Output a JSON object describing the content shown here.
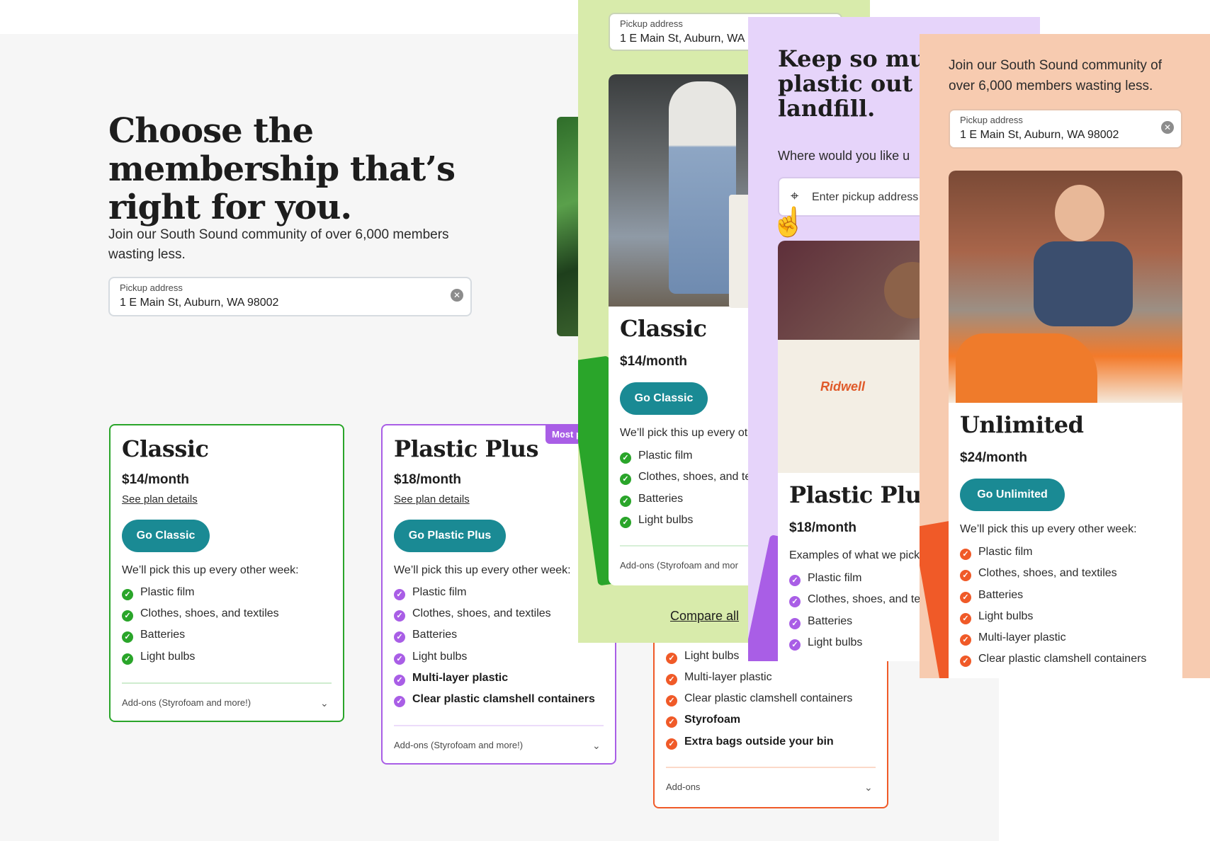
{
  "page": {
    "heading": "Choose the membership that’s right for you.",
    "subtext": "Join our South Sound community of over 6,000 members wasting less.",
    "address": {
      "label": "Pickup address",
      "value": "1 E Main St, Auburn, WA 98002"
    }
  },
  "colors": {
    "teal": "#1a8a94",
    "green": "#2aa52a",
    "purple": "#a95ee6",
    "orange": "#f05a28",
    "panel_green": "#d8ebab",
    "panel_purple": "#e6d4fa",
    "panel_peach": "#f7cbb0"
  },
  "cards": {
    "classic": {
      "title": "Classic",
      "price": "$14/month",
      "details": "See plan details",
      "button": "Go Classic",
      "intro": "We’ll pick this up every other week:",
      "features": [
        "Plastic film",
        "Clothes, shoes, and textiles",
        "Batteries",
        "Light bulbs"
      ],
      "addons": "Add-ons (Styrofoam and more!)"
    },
    "plastic_plus": {
      "title": "Plastic Plus",
      "price": "$18/month",
      "details": "See plan details",
      "button": "Go Plastic Plus",
      "badge": "Most p",
      "intro": "We’ll pick this up every other week:",
      "features": [
        "Plastic film",
        "Clothes, shoes, and textiles",
        "Batteries",
        "Light bulbs"
      ],
      "features_bold": [
        "Multi-layer plastic",
        "Clear plastic clamshell containers"
      ],
      "addons": "Add-ons (Styrofoam and more!)"
    },
    "unlimited": {
      "features": [
        "Light bulbs",
        "Multi-layer plastic",
        "Clear plastic clamshell containers"
      ],
      "features_bold": [
        "Styrofoam",
        "Extra bags outside your bin"
      ],
      "addons": "Add-ons"
    }
  },
  "mobile_green": {
    "address_label": "Pickup address",
    "address_value": "1 E Main St, Auburn, WA",
    "title": "Classic",
    "price": "$14/month",
    "button": "Go Classic",
    "intro": "We’ll pick this up every ot",
    "features": [
      "Plastic film",
      "Clothes, shoes, and te",
      "Batteries",
      "Light bulbs"
    ],
    "addons": "Add-ons (Styrofoam and mor",
    "compare": "Compare all"
  },
  "mobile_purple": {
    "headline_a": "Keep ",
    "headline_bold": "so much",
    "headline_b": "plastic out of t",
    "headline_c": "landfill.",
    "prompt": "Where would you like u",
    "placeholder": "Enter pickup address",
    "bag_brand": "Ridwell",
    "title": "Plastic Plus",
    "price": "$18/month",
    "intro": "Examples of what we pick",
    "features": [
      "Plastic film",
      "Clothes, shoes, and te",
      "Batteries",
      "Light bulbs"
    ]
  },
  "mobile_peach": {
    "subtext": "Join our South Sound community of over 6,000 members wasting less.",
    "address_label": "Pickup address",
    "address_value": "1 E Main St, Auburn, WA 98002",
    "title": "Unlimited",
    "price": "$24/month",
    "button": "Go Unlimited",
    "intro": "We’ll pick this up every other week:",
    "features": [
      "Plastic film",
      "Clothes, shoes, and textiles",
      "Batteries",
      "Light bulbs",
      "Multi-layer plastic",
      "Clear plastic clamshell containers"
    ]
  }
}
